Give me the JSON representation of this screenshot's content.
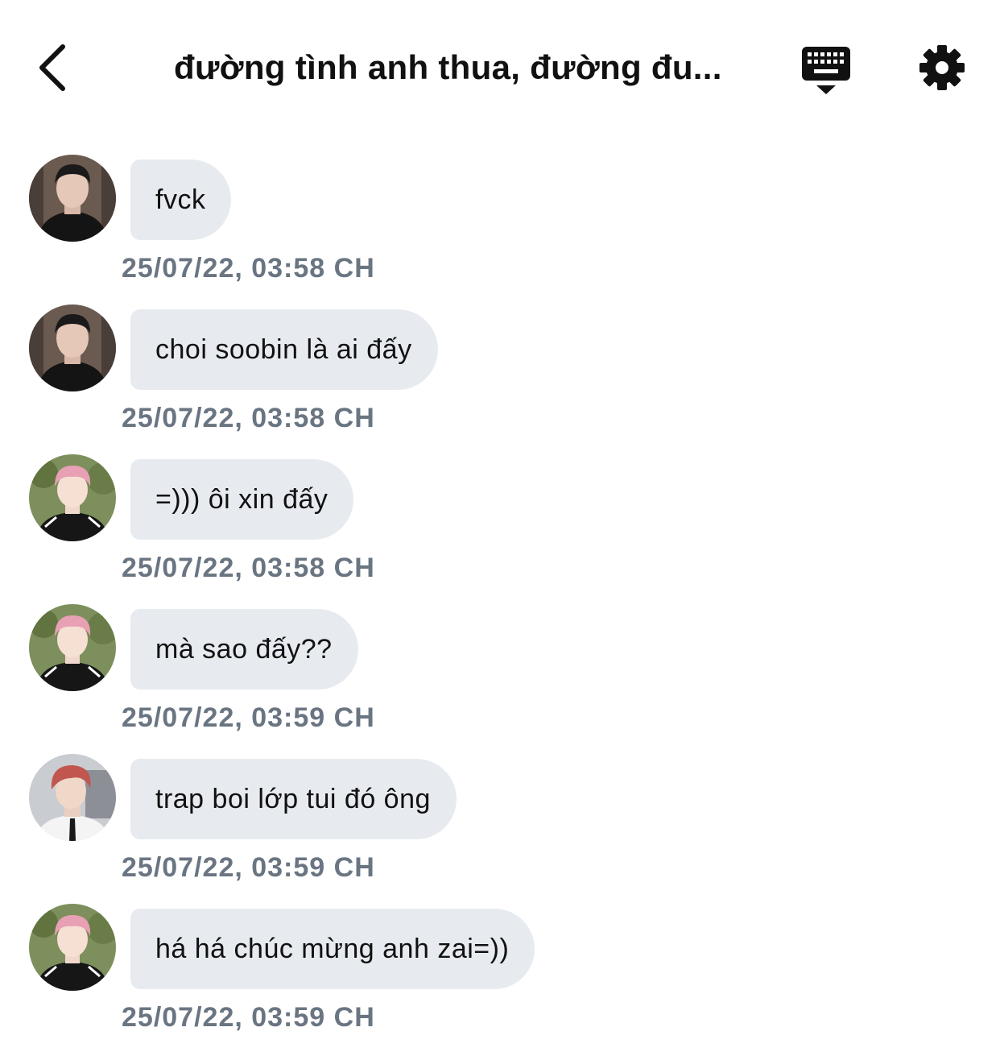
{
  "header": {
    "title": "đường tình anh thua, đường đu...",
    "back_icon": "chevron-left-icon",
    "keyboard_icon": "keyboard-hide-icon",
    "settings_icon": "gear-icon"
  },
  "messages": [
    {
      "text": "fvck",
      "time": "25/07/22, 03:58 CH",
      "avatar": "avatar-a"
    },
    {
      "text": "choi soobin là ai đấy",
      "time": "25/07/22, 03:58 CH",
      "avatar": "avatar-a"
    },
    {
      "text": "=))) ôi xin đấy",
      "time": "25/07/22, 03:58 CH",
      "avatar": "avatar-b"
    },
    {
      "text": "mà sao đấy??",
      "time": "25/07/22, 03:59 CH",
      "avatar": "avatar-b"
    },
    {
      "text": "trap boi lớp tui đó ông",
      "time": "25/07/22, 03:59 CH",
      "avatar": "avatar-c"
    },
    {
      "text": "há há chúc mừng anh zai=))",
      "time": "25/07/22, 03:59 CH",
      "avatar": "avatar-b"
    }
  ]
}
